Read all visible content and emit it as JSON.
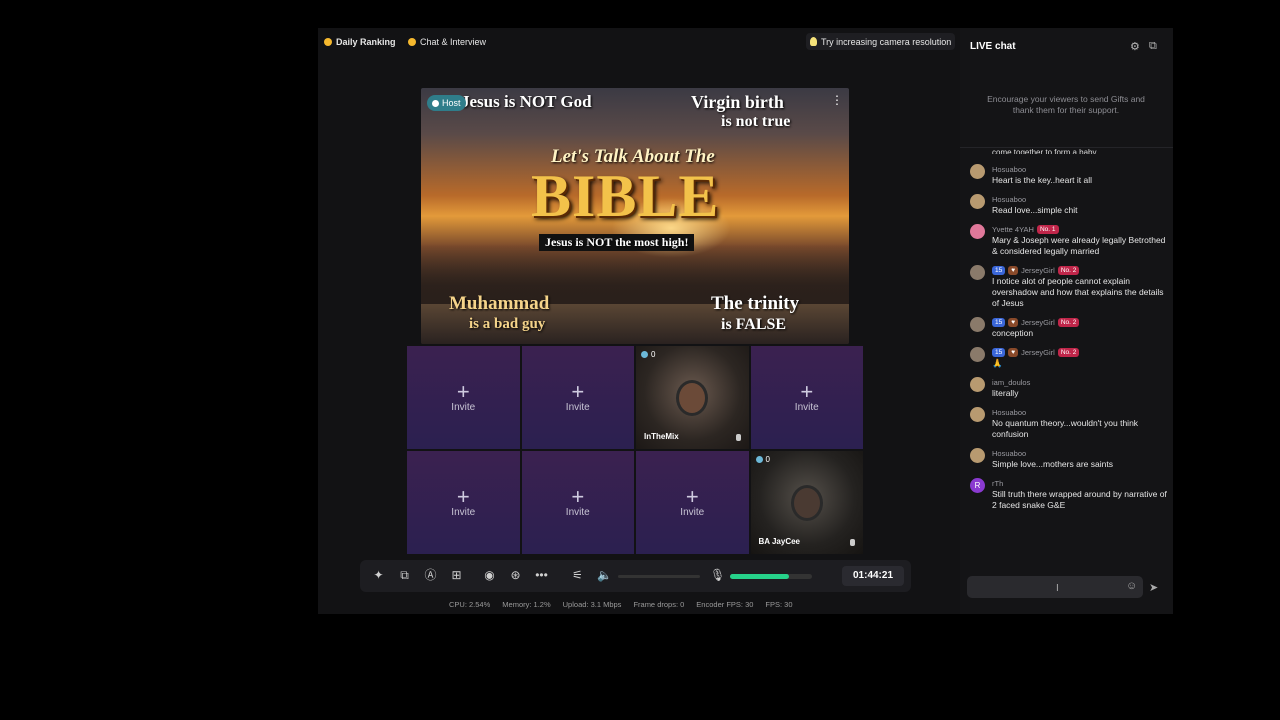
{
  "topbar": {
    "daily_ranking": "Daily Ranking",
    "chat_interview": "Chat & Interview",
    "tip": "Try increasing camera resolution"
  },
  "host": {
    "badge": "Host",
    "image_text": {
      "jesus_not_god": "Jesus is NOT God",
      "virgin_birth": "Virgin birth",
      "is_not_true": "is not true",
      "lets_talk": "Let's Talk About The",
      "bible": "BIBLE",
      "not_most_high": "Jesus is NOT the most high!",
      "muhammad": "Muhammad",
      "bad_guy": "is a bad guy",
      "trinity": "The trinity",
      "is_false": "is FALSE"
    }
  },
  "guests": {
    "invite_label": "Invite",
    "video1": {
      "count": "0",
      "name": "InTheMix"
    },
    "video2": {
      "count": "0",
      "name": "BA JayCee"
    }
  },
  "toolbar": {
    "timer": "01:44:21",
    "mic_level": 0.72
  },
  "stats": {
    "cpu": "CPU: 2.54%",
    "memory": "Memory: 1.2%",
    "upload": "Upload: 3.1 Mbps",
    "frame_drops": "Frame drops: 0",
    "encoder_fps": "Encoder FPS: 30",
    "fps": "FPS: 30"
  },
  "chat": {
    "title": "LIVE chat",
    "encourage": "Encourage your viewers to send Gifts and thank them for their support.",
    "partial": "come together to form a baby",
    "messages": [
      {
        "user": "Hosuaboo",
        "text": "Heart is the key..heart it all",
        "avatar": "tan"
      },
      {
        "user": "Hosuaboo",
        "text": "Read love...simple chit",
        "avatar": "tan"
      },
      {
        "user": "Yvette 4YAH",
        "badge_no": "No. 1",
        "text": "Mary & Joseph were already legally Betrothed & considered legally married",
        "avatar": "pink"
      },
      {
        "user": "JerseyGirl",
        "lvl": "15",
        "badge_no": "No. 2",
        "text": "I notice alot of people cannot explain overshadow and how that explains the details of Jesus",
        "avatar": "grey"
      },
      {
        "user": "JerseyGirl",
        "lvl": "15",
        "badge_no": "No. 2",
        "text": "conception",
        "avatar": "grey"
      },
      {
        "user": "JerseyGirl",
        "lvl": "15",
        "badge_no": "No. 2",
        "text": "🙏",
        "avatar": "grey"
      },
      {
        "user": "iam_doulos",
        "text": "literally",
        "avatar": "tan"
      },
      {
        "user": "Hosuaboo",
        "text": "No quantum theory...wouldn't you think confusion",
        "avatar": "tan"
      },
      {
        "user": "Hosuaboo",
        "text": "Simple love...mothers are saints",
        "avatar": "tan"
      },
      {
        "user": "rTh",
        "text": "Still truth there wrapped around by narrative of 2 faced snake G&E",
        "avatar": "purple",
        "initial": "R"
      }
    ]
  }
}
